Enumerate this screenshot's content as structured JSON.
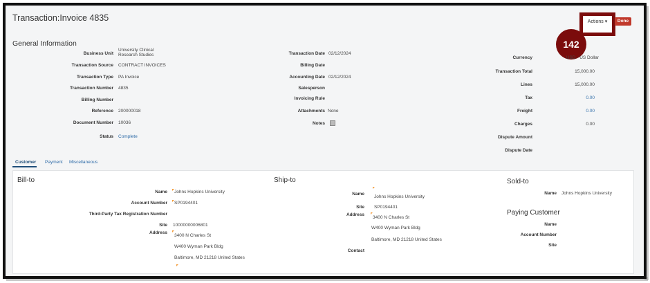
{
  "page": {
    "title": "Transaction:Invoice 4835",
    "actions_label": "Actions",
    "done_label": "Done",
    "badge": "142",
    "general_info_title": "General Information"
  },
  "general": {
    "left": [
      {
        "label": "Business Unit",
        "value": "University Clinical\nResearch Studies"
      },
      {
        "label": "Transaction Source",
        "value": "CONTRACT INVOICES"
      },
      {
        "label": "Transaction Type",
        "value": "PA Invoice"
      },
      {
        "label": "Transaction Number",
        "value": "4835"
      },
      {
        "label": "Billing Number",
        "value": ""
      },
      {
        "label": "Reference",
        "value": "200000018"
      },
      {
        "label": "Document Number",
        "value": "10036"
      },
      {
        "label": "Status",
        "value": "Complete"
      }
    ],
    "middle": [
      {
        "label": "Transaction Date",
        "value": "02/12/2024"
      },
      {
        "label": "Billing Date",
        "value": ""
      },
      {
        "label": "Accounting Date",
        "value": "02/12/2024"
      },
      {
        "label": "Salesperson",
        "value": ""
      },
      {
        "label": "Invoicing Rule",
        "value": ""
      },
      {
        "label": "Attachments",
        "value": "None"
      },
      {
        "label": "Notes",
        "value": ""
      }
    ],
    "right": [
      {
        "label": "Currency",
        "value": "USD - US Dollar"
      },
      {
        "label": "Transaction Total",
        "value": "15,000.00"
      },
      {
        "label": "Lines",
        "value": "15,000.00"
      },
      {
        "label": "Tax",
        "value": "0.00"
      },
      {
        "label": "Freight",
        "value": "0.00"
      },
      {
        "label": "Charges",
        "value": "0.00"
      },
      {
        "label": "Dispute Amount",
        "value": ""
      },
      {
        "label": "Dispute Date",
        "value": ""
      }
    ]
  },
  "tabs": [
    "Customer",
    "Payment",
    "Miscellaneous"
  ],
  "billto": {
    "title": "Bill-to",
    "name_label": "Name",
    "name": "Johns Hopkins University",
    "account_label": "Account Number",
    "account": "SP0194401",
    "tax_label": "Third-Party Tax Registration Number",
    "site_label": "Site",
    "site": "10000000006801",
    "address_label": "Address",
    "address1": "3400 N Charles St",
    "address2": "W400 Wyman Park Bldg",
    "address3": "Baltimore, MD 21218 United States"
  },
  "shipto": {
    "title": "Ship-to",
    "name_label": "Name",
    "name": "Johns Hopkins University",
    "site_label": "Site",
    "site": "SP0194401",
    "address_label": "Address",
    "address1": "3400 N Charles St",
    "address2": "W400 Wyman Park Bldg",
    "address3": "Baltimore, MD 21218 United States",
    "contact_label": "Contact"
  },
  "soldto": {
    "title": "Sold-to",
    "name_label": "Name",
    "name": "Johns Hopkins University"
  },
  "paying": {
    "title": "Paying Customer",
    "name_label": "Name",
    "account_label": "Account Number",
    "site_label": "Site"
  }
}
